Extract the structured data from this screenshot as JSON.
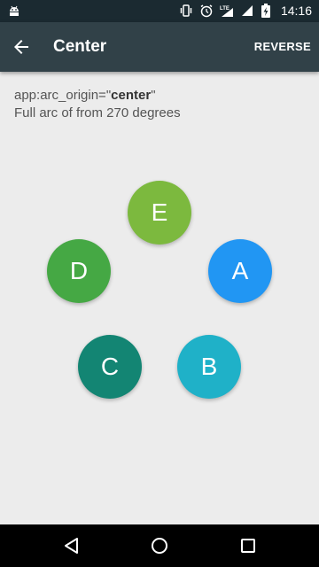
{
  "status_bar": {
    "time": "14:16",
    "icons": [
      "android-debug-icon",
      "vibrate-icon",
      "alarm-icon",
      "lte-icon",
      "signal-icon",
      "battery-charging-icon"
    ]
  },
  "app_bar": {
    "title": "Center",
    "action_label": "REVERSE"
  },
  "description": {
    "line1_prefix": "app:arc_origin=\"",
    "line1_value": "center",
    "line1_suffix": "\"",
    "line2": "Full arc of from 270 degrees"
  },
  "buttons": [
    {
      "label": "A",
      "color": "#2196f3"
    },
    {
      "label": "B",
      "color": "#1fb1c8"
    },
    {
      "label": "C",
      "color": "#138573"
    },
    {
      "label": "D",
      "color": "#45a844"
    },
    {
      "label": "E",
      "color": "#7cb93e"
    }
  ],
  "nav_bar": {
    "icons": [
      "back-triangle-icon",
      "home-circle-icon",
      "recents-square-icon"
    ]
  },
  "colors": {
    "status_bar": "#1b2a31",
    "app_bar": "#314148",
    "background": "#ececec"
  }
}
